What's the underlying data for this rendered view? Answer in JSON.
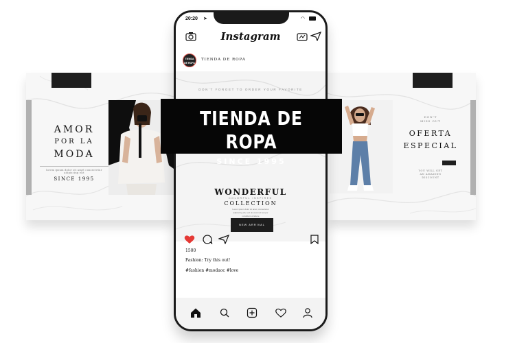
{
  "left_panel": {
    "line1": "AMOR",
    "line2": "POR LA",
    "line3": "MODA",
    "fine_print": "lorem ipsum dolor sit amet consectetur adipiscing elit",
    "since": "SINCE 1995"
  },
  "right_panel": {
    "dont_forget_1": "DON'T",
    "dont_forget_2": "MISS OUT",
    "title_1": "OFERTA",
    "title_2": "ESPECIAL",
    "fine_print_1": "YOU WILL GET",
    "fine_print_2": "AN AMAZING",
    "fine_print_3": "DISCOUNT"
  },
  "phone": {
    "status_time": "20:20",
    "app_title": "Instagram",
    "profile_name": "TIENDA DE ROPA",
    "avatar_text_1": "TIENDA",
    "avatar_text_2": "DE ROPA",
    "post": {
      "dont_forget": "DON'T FORGET TO ORDER YOUR FAVORITE",
      "wonderful": "WONDERFUL",
      "colorful": "COLORFUL INSPIRED",
      "collection": "COLLECTION",
      "body_1": "Lorem ipsum dolor sit amet, consectetur",
      "body_2": "adipiscing elit, sed do eiusmod tempor",
      "body_3": "incididunt ut labore",
      "button": "NEW ARRIVAL"
    },
    "likes": "1500",
    "caption": "Fashion: Try this out!",
    "hashtags": "#fashion #modaoc #love"
  },
  "banner": {
    "title": "TIENDA DE ROPA",
    "subtitle": "SINCE 1995"
  },
  "colors": {
    "like_heart": "#e53935",
    "banner_bg": "#060606",
    "phone_frame": "#1a1a1a"
  }
}
